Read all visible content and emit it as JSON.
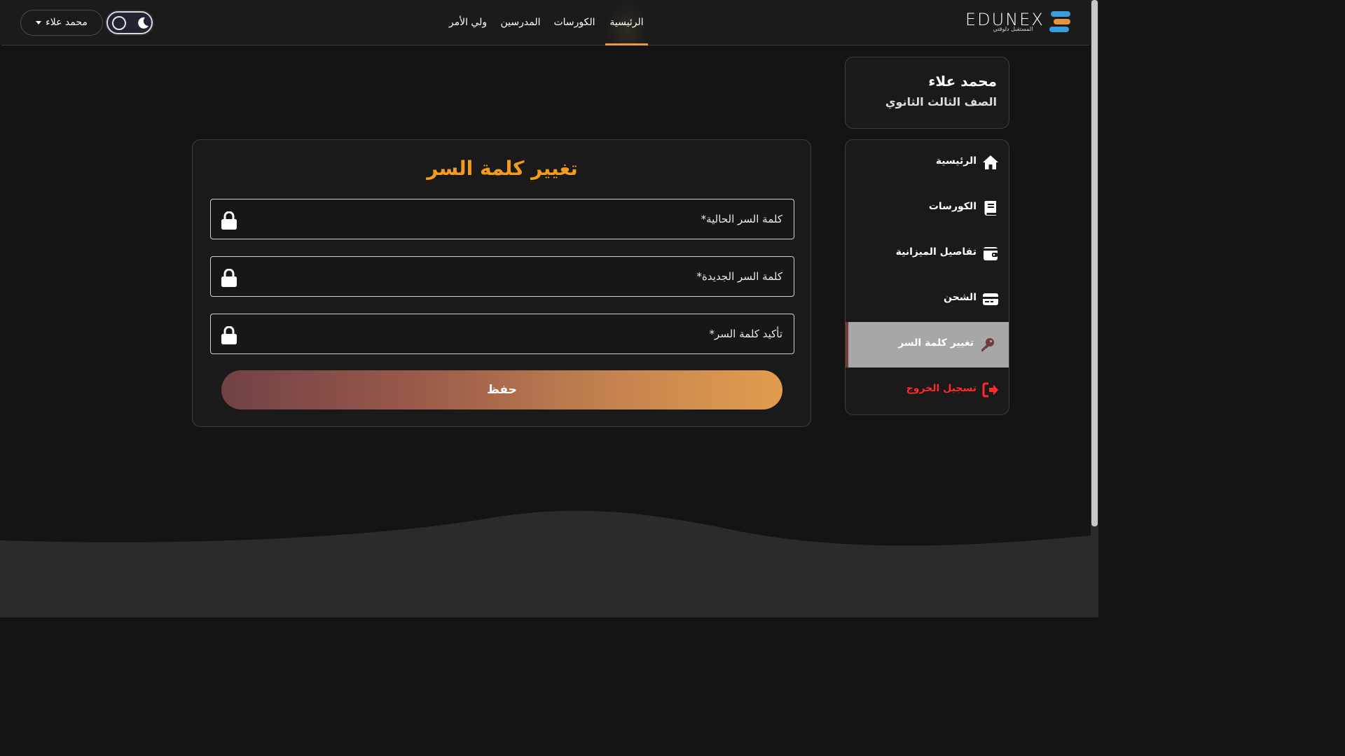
{
  "brand": {
    "logo_text": "EDUNEX",
    "tagline": "المستقبل دلوقتي"
  },
  "nav": {
    "items": [
      {
        "label": "الرئيسية",
        "active": true
      },
      {
        "label": "الكورسات",
        "active": false
      },
      {
        "label": "المدرسين",
        "active": false
      },
      {
        "label": "ولي الأمر",
        "active": false
      }
    ]
  },
  "theme_toggle": {
    "icon_on": "moon-icon",
    "state": "dark"
  },
  "user_menu": {
    "label": "محمد علاء"
  },
  "profile": {
    "name": "محمد علاء",
    "grade": "الصف الثالث الثانوي"
  },
  "sidebar": {
    "items": [
      {
        "label": "الرئيسية",
        "icon": "home-icon"
      },
      {
        "label": "الكورسات",
        "icon": "book-icon"
      },
      {
        "label": "تفاصيل الميزانية",
        "icon": "wallet-icon"
      },
      {
        "label": "الشحن",
        "icon": "credit-card-icon"
      },
      {
        "label": "تغيير كلمة السر",
        "icon": "key-icon",
        "active": true
      },
      {
        "label": "تسجيل الخروج",
        "icon": "logout-icon"
      }
    ]
  },
  "form": {
    "title": "تغيير كلمة السر",
    "fields": [
      {
        "label": "كلمة السر الحالية",
        "required_mark": "*"
      },
      {
        "label": "كلمة السر الجديدة",
        "required_mark": "*"
      },
      {
        "label": "تأكيد كلمة السر",
        "required_mark": "*"
      }
    ],
    "submit_label": "حفظ"
  },
  "colors": {
    "accent": "#f39b1e",
    "nav_active_underline": "#e89a45",
    "logout": "#ff2a2a",
    "button_gradient_start": "#714146",
    "button_gradient_end": "#e29c4d"
  }
}
